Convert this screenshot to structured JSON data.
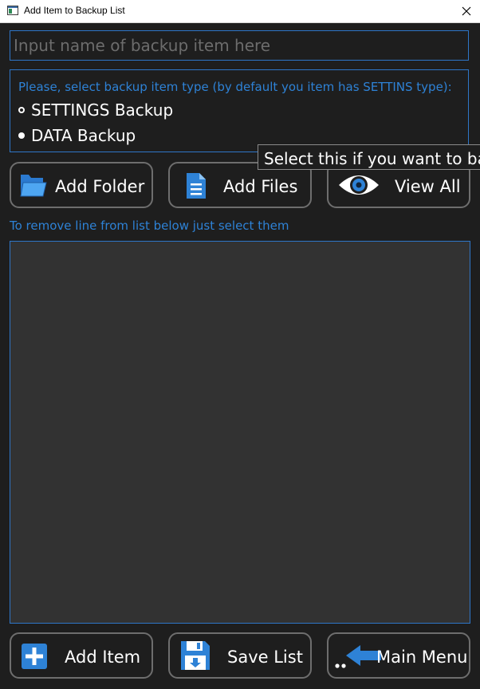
{
  "window": {
    "title": "Add Item to Backup List",
    "close_label": "×"
  },
  "name_input": {
    "placeholder": "Input name of backup item here",
    "value": ""
  },
  "item_type": {
    "hint": "Please, select backup item type (by default you item has SETTINS type):",
    "options": [
      {
        "label": "SETTINGS Backup",
        "selected": true
      },
      {
        "label": "DATA Backup",
        "selected": false
      }
    ]
  },
  "tooltip": {
    "text": "Select this if you want to backup data"
  },
  "toolbar": {
    "add_folder": {
      "label": "Add Folder",
      "icon": "folder-icon"
    },
    "add_files": {
      "label": "Add Files",
      "icon": "file-icon"
    },
    "view_all": {
      "label": "View All",
      "icon": "eye-icon"
    }
  },
  "list": {
    "hint": "To remove line from list below just select them",
    "items": []
  },
  "footer": {
    "add_item": {
      "label": "Add Item",
      "icon": "plus-icon"
    },
    "save_list": {
      "label": "Save List",
      "icon": "floppy-disk-icon"
    },
    "main_menu": {
      "label": "Main Menu",
      "icon": "back-arrow-icon"
    }
  },
  "colors": {
    "background": "#1e1e1e",
    "accent": "#2e76c8",
    "hint_text": "#2e82d6",
    "list_background": "#323232",
    "button_border": "#6e6e6e"
  }
}
